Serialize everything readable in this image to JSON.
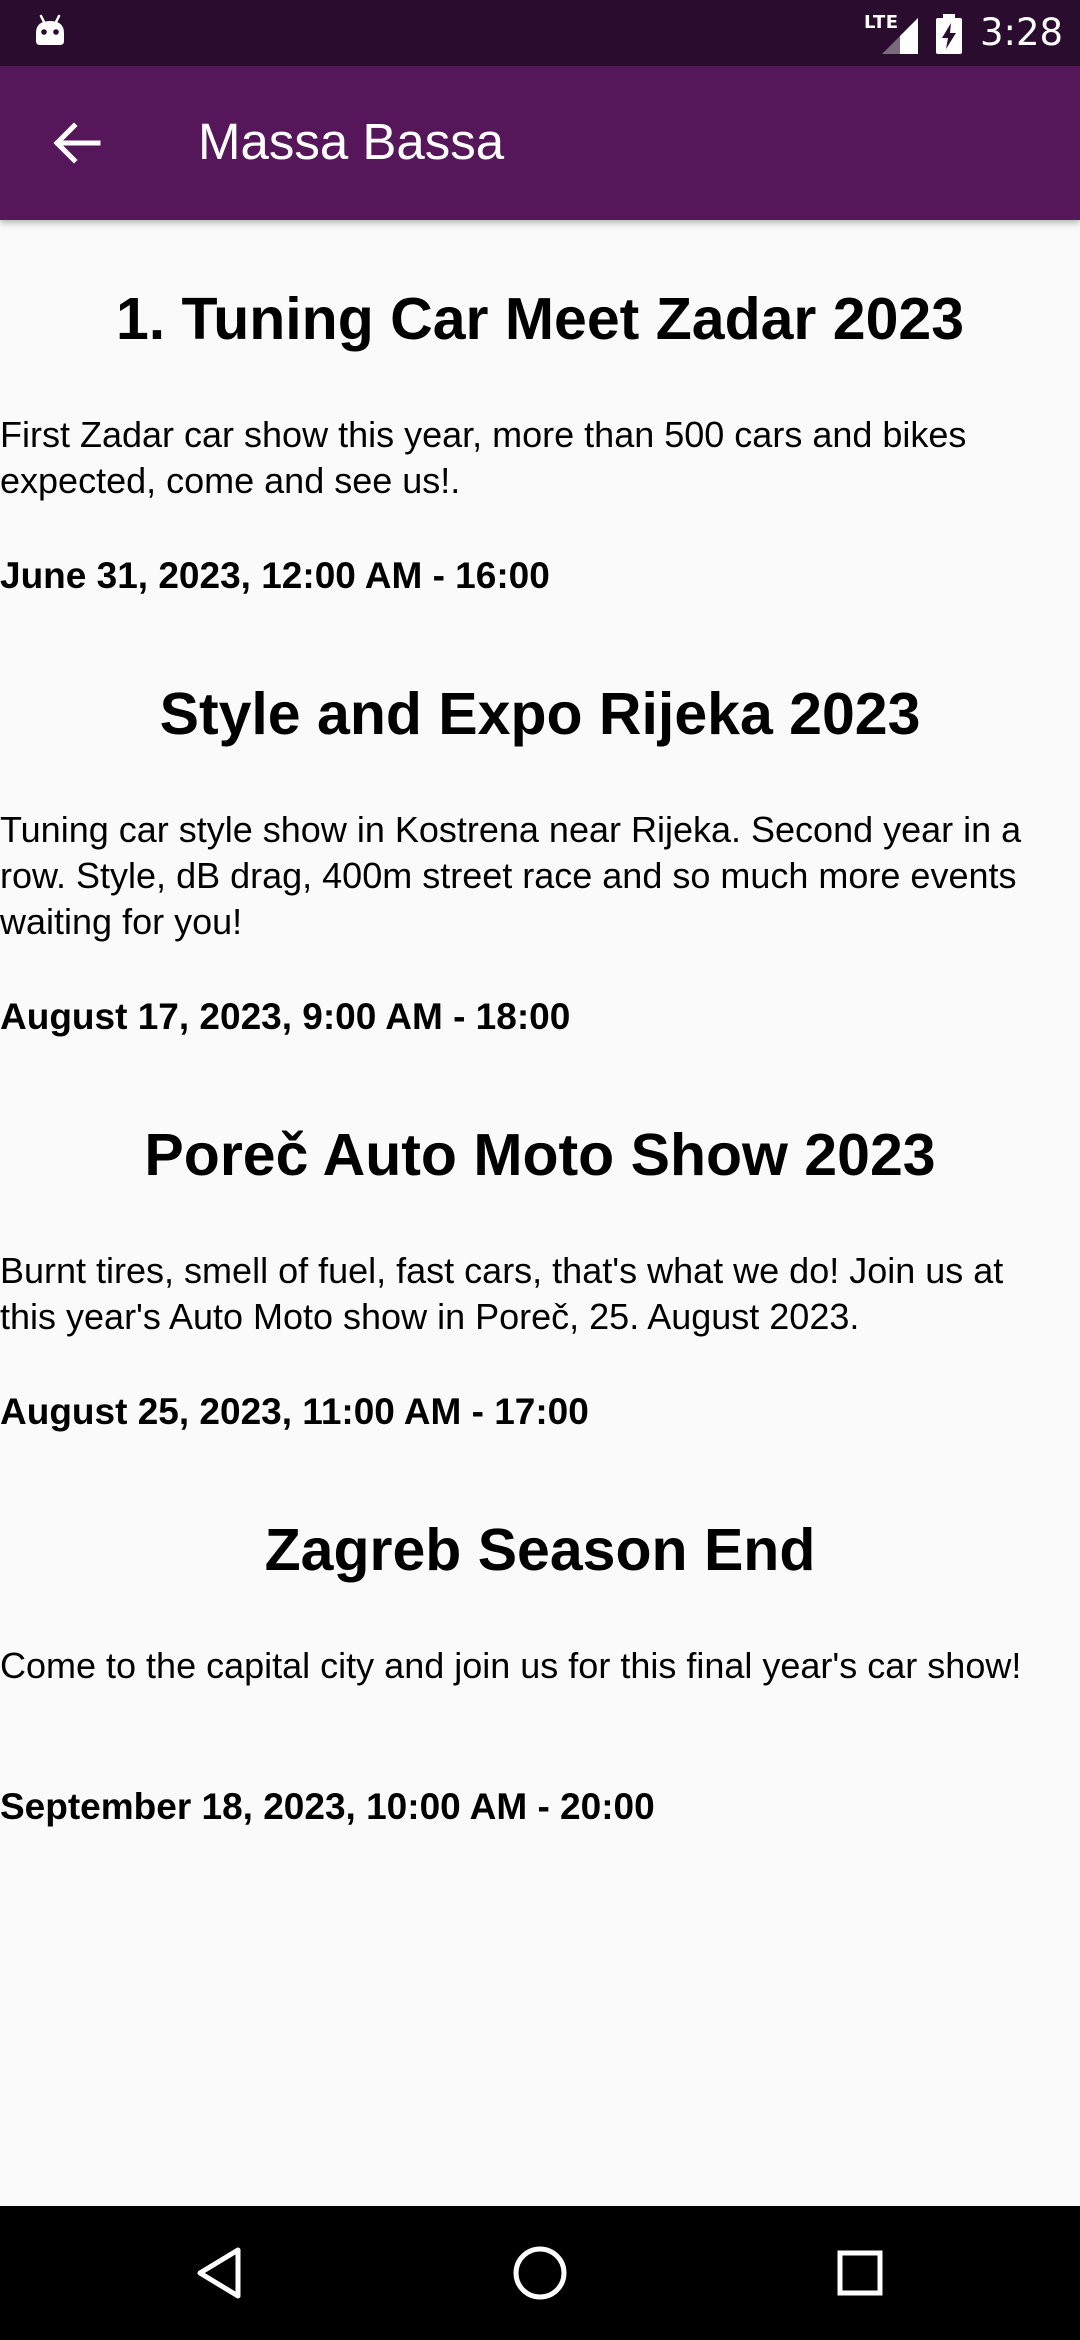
{
  "status_bar": {
    "network": "LTE",
    "time": "3:28",
    "icons": [
      "android-robot-icon",
      "signal-icon",
      "battery-charging-icon"
    ]
  },
  "app_bar": {
    "title": "Massa Bassa",
    "back_icon": "arrow-left-icon"
  },
  "events": [
    {
      "title": "1. Tuning Car Meet Zadar 2023",
      "description": "First Zadar car show this year, more than 500 cars and bikes expected, come and see us!.",
      "datetime": "June 31, 2023, 12:00 AM - 16:00"
    },
    {
      "title": "Style and Expo Rijeka 2023",
      "description": "Tuning car style show in Kostrena near Rijeka. Second year in a row. Style, dB drag, 400m street race and so much more events waiting for you!",
      "datetime": "August 17, 2023, 9:00 AM - 18:00"
    },
    {
      "title": "Poreč Auto Moto Show 2023",
      "description": "Burnt tires, smell of fuel, fast cars, that's what we do! Join us at this year's Auto Moto show in Poreč, 25. August 2023.",
      "datetime": "August 25, 2023, 11:00 AM - 17:00"
    },
    {
      "title": "Zagreb Season End",
      "description": "Come to the capital city and join us for this final year's car show!",
      "datetime": "September 18, 2023, 10:00 AM - 20:00"
    }
  ],
  "nav_bar": {
    "icons": [
      "back-triangle-icon",
      "home-circle-icon",
      "recents-square-icon"
    ]
  },
  "colors": {
    "status_bar": "#2a0d2e",
    "app_bar": "#56175a",
    "background": "#fafafa",
    "nav_bar": "#000000"
  }
}
